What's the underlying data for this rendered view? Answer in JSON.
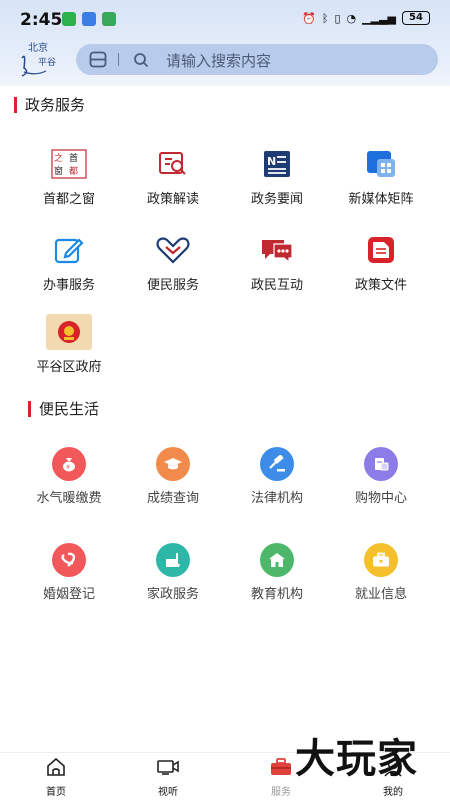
{
  "status": {
    "time": "2:45",
    "battery": "54"
  },
  "search": {
    "placeholder": "请输入搜索内容"
  },
  "sections": {
    "gov": {
      "title": "政务服务"
    },
    "life": {
      "title": "便民生活"
    }
  },
  "gov_items": [
    {
      "label": "首都之窗",
      "icon": "capital-window-icon"
    },
    {
      "label": "政策解读",
      "icon": "policy-read-icon"
    },
    {
      "label": "政务要闻",
      "icon": "news-icon"
    },
    {
      "label": "新媒体矩阵",
      "icon": "media-matrix-icon"
    },
    {
      "label": "办事服务",
      "icon": "edit-icon"
    },
    {
      "label": "便民服务",
      "icon": "handshake-icon"
    },
    {
      "label": "政民互动",
      "icon": "chat-icon"
    },
    {
      "label": "政策文件",
      "icon": "document-icon"
    },
    {
      "label": "平谷区政府",
      "icon": "emblem-icon"
    }
  ],
  "life_items": [
    {
      "label": "水气暖缴费",
      "icon": "money-bag-icon",
      "color": "#f0585a"
    },
    {
      "label": "成绩查询",
      "icon": "graduation-cap-icon",
      "color": "#f28a4b"
    },
    {
      "label": "法律机构",
      "icon": "gavel-icon",
      "color": "#3d8de8"
    },
    {
      "label": "购物中心",
      "icon": "shopping-icon",
      "color": "#8b7ce8"
    },
    {
      "label": "婚姻登记",
      "icon": "marriage-icon",
      "color": "#f0585a"
    },
    {
      "label": "家政服务",
      "icon": "housekeeping-icon",
      "color": "#2cb7a6"
    },
    {
      "label": "教育机构",
      "icon": "school-icon",
      "color": "#4db86a"
    },
    {
      "label": "就业信息",
      "icon": "briefcase-icon",
      "color": "#f5c02c"
    }
  ],
  "tabs": [
    {
      "label": "首页",
      "icon": "home-icon"
    },
    {
      "label": "视听",
      "icon": "video-icon"
    },
    {
      "label": "服务",
      "icon": "toolbox-icon"
    },
    {
      "label": "我的",
      "icon": "user-icon"
    }
  ],
  "watermark": "大玩家",
  "colors": {
    "accent": "#d8232a",
    "header": "#d7e4f6",
    "search": "#b9cbea"
  }
}
